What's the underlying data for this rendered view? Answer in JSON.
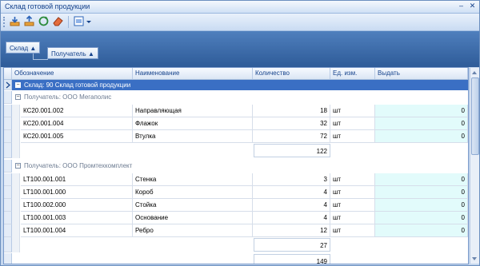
{
  "window": {
    "title": "Склад готовой продукции"
  },
  "group_panel": {
    "chip1": "Склад ▲",
    "chip2": "Получатель ▲"
  },
  "columns": [
    "Обозначение",
    "Наименование",
    "Количество",
    "Ед. изм.",
    "Выдать"
  ],
  "warehouse_group": "Склад: 90 Склад готовой продукции",
  "groups": [
    {
      "label": "Получатель: ООО Мегаполис",
      "rows": [
        {
          "code": "КС20.001.002",
          "name": "Направляющая",
          "qty": "18",
          "unit": "шт",
          "issue": "0"
        },
        {
          "code": "КС20.001.004",
          "name": "Флажок",
          "qty": "32",
          "unit": "шт",
          "issue": "0"
        },
        {
          "code": "КС20.001.005",
          "name": "Втулка",
          "qty": "72",
          "unit": "шт",
          "issue": "0"
        }
      ],
      "total": "122"
    },
    {
      "label": "Получатель: ООО Промтехкомплект",
      "rows": [
        {
          "code": "LT100.001.001",
          "name": "Стенка",
          "qty": "3",
          "unit": "шт",
          "issue": "0"
        },
        {
          "code": "LT100.001.000",
          "name": "Короб",
          "qty": "4",
          "unit": "шт",
          "issue": "0"
        },
        {
          "code": "LT100.002.000",
          "name": "Стойка",
          "qty": "4",
          "unit": "шт",
          "issue": "0"
        },
        {
          "code": "LT100.001.003",
          "name": "Основание",
          "qty": "4",
          "unit": "шт",
          "issue": "0"
        },
        {
          "code": "LT100.001.004",
          "name": "Ребро",
          "qty": "12",
          "unit": "шт",
          "issue": "0"
        }
      ],
      "total": "27"
    }
  ],
  "grand_total": "149",
  "colors": {
    "selection": "#3a6fc4",
    "issue_cell": "#e2fbfb",
    "group_panel": "#2e5b98"
  }
}
